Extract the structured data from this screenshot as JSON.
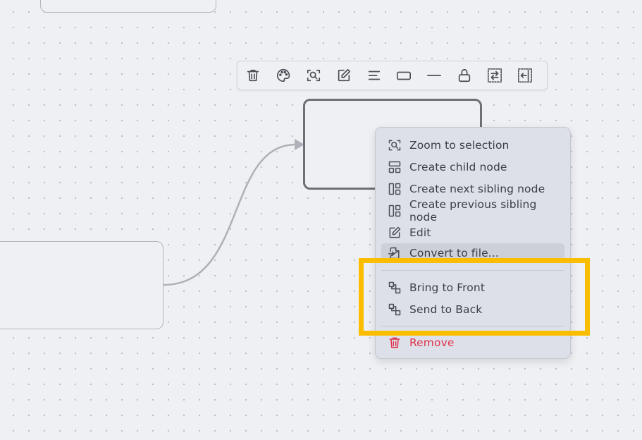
{
  "toolbar": {
    "buttons": [
      {
        "icon": "trash-icon"
      },
      {
        "icon": "palette-icon"
      },
      {
        "icon": "zoom-selection-icon"
      },
      {
        "icon": "edit-icon"
      },
      {
        "icon": "align-icon"
      },
      {
        "icon": "rectangle-shape-icon"
      },
      {
        "icon": "line-icon"
      },
      {
        "icon": "lock-icon"
      },
      {
        "icon": "swap-direction-icon"
      },
      {
        "icon": "collapse-left-icon"
      }
    ]
  },
  "context_menu": {
    "items": [
      {
        "label": "Zoom to selection",
        "icon": "zoom-selection-icon"
      },
      {
        "label": "Create child node",
        "icon": "child-node-icon"
      },
      {
        "label": "Create next sibling node",
        "icon": "sibling-node-icon"
      },
      {
        "label": "Create previous sibling node",
        "icon": "sibling-node-icon"
      },
      {
        "label": "Edit",
        "icon": "edit-icon"
      },
      {
        "label": "Convert to file...",
        "icon": "file-convert-icon"
      },
      {
        "label": "Bring to Front",
        "icon": "bring-to-front-icon"
      },
      {
        "label": "Send to Back",
        "icon": "send-to-back-icon"
      },
      {
        "label": "Remove",
        "icon": "trash-icon"
      }
    ]
  },
  "colors": {
    "canvas": "#eff0f4",
    "menu_bg": "#dde0e8",
    "danger": "#e0314a",
    "highlight": "#fbbd00"
  }
}
